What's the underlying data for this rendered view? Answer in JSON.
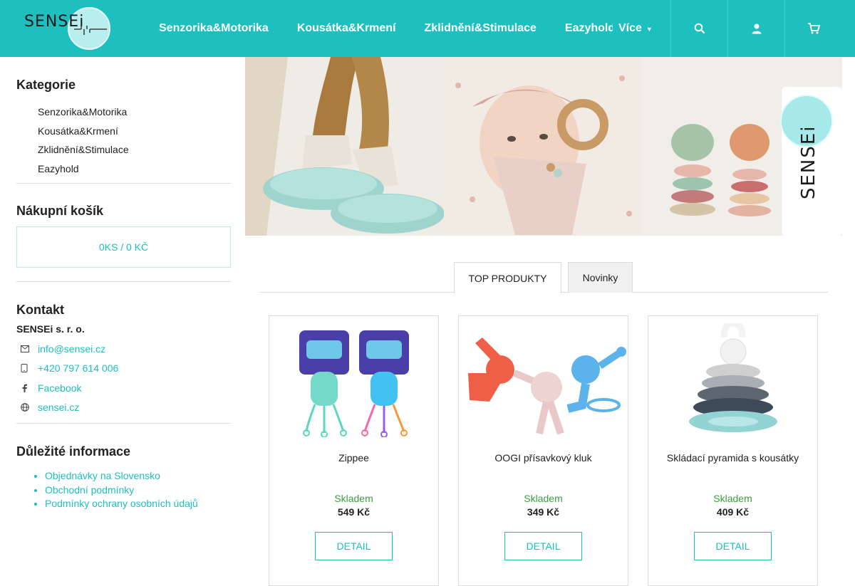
{
  "header": {
    "logo_text": "SENSEi",
    "nav": [
      "Senzorika&Motorika",
      "Kousátka&Krmení",
      "Zklidnění&Stimulace",
      "Eazyhold"
    ],
    "more_label": "Více",
    "icons": [
      "search-icon",
      "user-icon",
      "cart-icon"
    ]
  },
  "sidebar": {
    "categories_title": "Kategorie",
    "categories": [
      "Senzorika&Motorika",
      "Kousátka&Krmení",
      "Zklidnění&Stimulace",
      "Eazyhold"
    ],
    "cart_title": "Nákupní košík",
    "cart_summary": "0KS / 0 KČ",
    "contact_title": "Kontakt",
    "company": "SENSEi s. r. o.",
    "contacts": [
      {
        "icon": "mail-icon",
        "label": "info@sensei.cz"
      },
      {
        "icon": "phone-icon",
        "label": "+420 797 614 006"
      },
      {
        "icon": "facebook-icon",
        "label": "Facebook"
      },
      {
        "icon": "globe-icon",
        "label": "sensei.cz"
      }
    ],
    "info_title": "Důležité informace",
    "info_links": [
      "Objednávky na Slovensko",
      "Obchodní podmínky",
      "Podmínky ochrany osobních údajů"
    ]
  },
  "banner": {
    "brand_text": "SENSEi"
  },
  "tabs": [
    {
      "label": "TOP PRODUKTY",
      "active": true
    },
    {
      "label": "Novinky",
      "active": false
    }
  ],
  "products": [
    {
      "name": "Zippee",
      "stock": "Skladem",
      "price": "549 Kč",
      "button": "DETAIL"
    },
    {
      "name": "OOGI přísavkový kluk",
      "stock": "Skladem",
      "price": "349 Kč",
      "button": "DETAIL"
    },
    {
      "name": "Skládací pyramida s kousátky",
      "stock": "Skladem",
      "price": "409 Kč",
      "button": "DETAIL"
    }
  ],
  "colors": {
    "accent": "#1dbfbf",
    "stock_green": "#3aa03a"
  }
}
